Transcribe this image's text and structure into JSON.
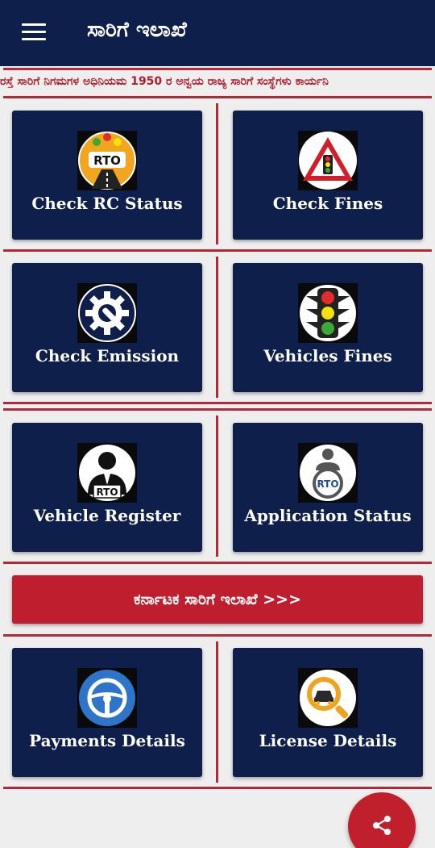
{
  "app_bar": {
    "title": "ಸಾರಿಗೆ ಇಲಾಖೆ",
    "menu_icon": "hamburger-menu-icon"
  },
  "marquee": {
    "text": "ರಸ್ತೆ ಸಾರಿಗೆ ನಿಗಮಗಳ ಅಧಿನಿಯಮ 1950 ರ ಅನ್ವಯ ರಾಜ್ಯ ಸಾರಿಗೆ ಸಂಸ್ಥೆಗಳು ಕಾರ್ಯನಿ"
  },
  "cards": [
    {
      "label": "Check RC Status",
      "icon": "rto-road-icon"
    },
    {
      "label": "Check Fines",
      "icon": "traffic-warning-sign-icon"
    },
    {
      "label": "Check Emission",
      "icon": "gear-wrench-icon"
    },
    {
      "label": "Vehicles Fines",
      "icon": "traffic-light-icon"
    },
    {
      "label": "Vehicle Register",
      "icon": "rto-officer-icon"
    },
    {
      "label": "Application Status",
      "icon": "rto-user-badge-icon"
    },
    {
      "label": "Payments Details",
      "icon": "steering-wheel-icon"
    },
    {
      "label": "License Details",
      "icon": "car-search-icon"
    }
  ],
  "banner": {
    "label": "ಕರ್ನಾಟಕ ಸಾರಿಗೆ ಇಲಾಖೆ >>>"
  },
  "fab": {
    "icon": "share-icon"
  },
  "colors": {
    "primary": "#0f1f4b",
    "accent": "#bf1e2e",
    "divider": "#b22a36",
    "background": "#eeeeee"
  }
}
